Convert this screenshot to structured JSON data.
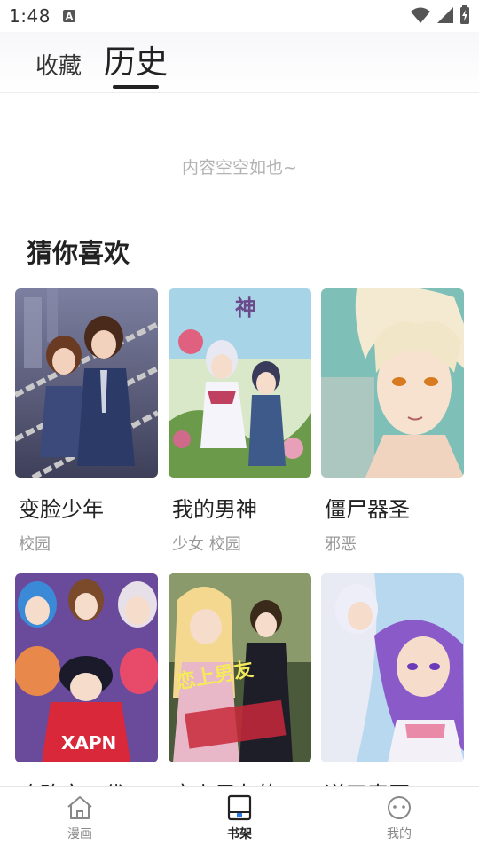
{
  "status_bar": {
    "time": "1:48",
    "notification_badge": "A",
    "icons": [
      "wifi-icon",
      "signal-icon",
      "battery-icon"
    ]
  },
  "tabs": [
    {
      "label": "收藏",
      "active": false
    },
    {
      "label": "历史",
      "active": true
    }
  ],
  "empty_state": "内容空空如也~",
  "recommend": {
    "title": "猜你喜欢",
    "items": [
      {
        "title": "变脸少年",
        "tags": "校园"
      },
      {
        "title": "我的男神",
        "tags": "少女 校园"
      },
      {
        "title": "僵尸器圣",
        "tags": "邪恶"
      },
      {
        "title": "攻略宅二代",
        "tags": ""
      },
      {
        "title": "恋上男友的",
        "tags": ""
      },
      {
        "title": "逆天毒医",
        "tags": ""
      }
    ]
  },
  "bottom_nav": [
    {
      "label": "漫画",
      "icon": "home-icon",
      "active": false
    },
    {
      "label": "书架",
      "icon": "bookshelf-icon",
      "active": true
    },
    {
      "label": "我的",
      "icon": "profile-icon",
      "active": false
    }
  ],
  "colors": {
    "text_primary": "#222222",
    "text_muted": "#999999",
    "empty_text": "#b3b3b3"
  }
}
